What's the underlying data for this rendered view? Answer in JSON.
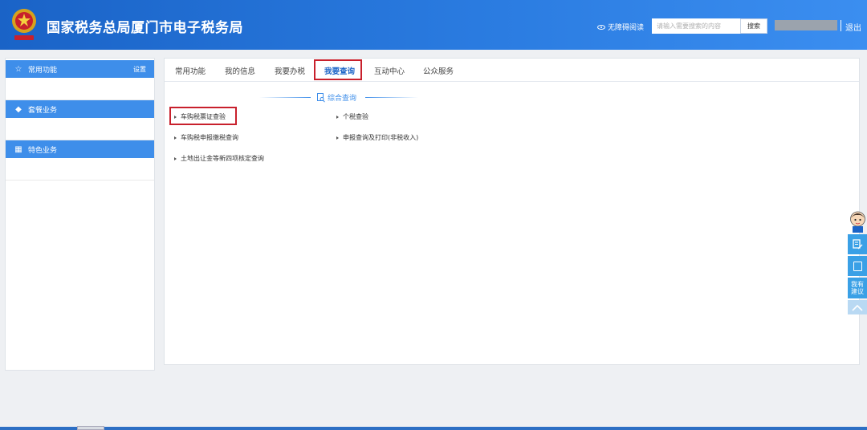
{
  "header": {
    "site_title": "国家税务总局厦门市电子税务局",
    "accessibility": "无障碍阅读",
    "search_placeholder": "请输入需要搜索的内容",
    "search_button": "搜索",
    "logout": "退出"
  },
  "sidebar": {
    "sections": [
      {
        "label": "常用功能",
        "icon": "star-icon",
        "action": "设置"
      },
      {
        "label": "套餐业务",
        "icon": "cube-icon"
      },
      {
        "label": "特色业务",
        "icon": "grid-icon"
      }
    ]
  },
  "tabs": [
    {
      "label": "常用功能"
    },
    {
      "label": "我的信息"
    },
    {
      "label": "我要办税"
    },
    {
      "label": "我要查询",
      "active": true
    },
    {
      "label": "互动中心"
    },
    {
      "label": "公众服务"
    }
  ],
  "section": {
    "title": "综合查询",
    "items": [
      {
        "label": "车购税票证查验"
      },
      {
        "label": "个税查验"
      },
      {
        "label": "车购税申报缴税查询"
      },
      {
        "label": "申报查询及打印(非税收入)"
      },
      {
        "label": "土地出让金等新四项核定查询"
      }
    ]
  },
  "float_toolbar": {
    "suggest_line1": "我有",
    "suggest_line2": "建议"
  },
  "colors": {
    "header_blue": "#1a63c7",
    "accent_blue": "#3e8eea",
    "highlight_red": "#c8202c"
  }
}
